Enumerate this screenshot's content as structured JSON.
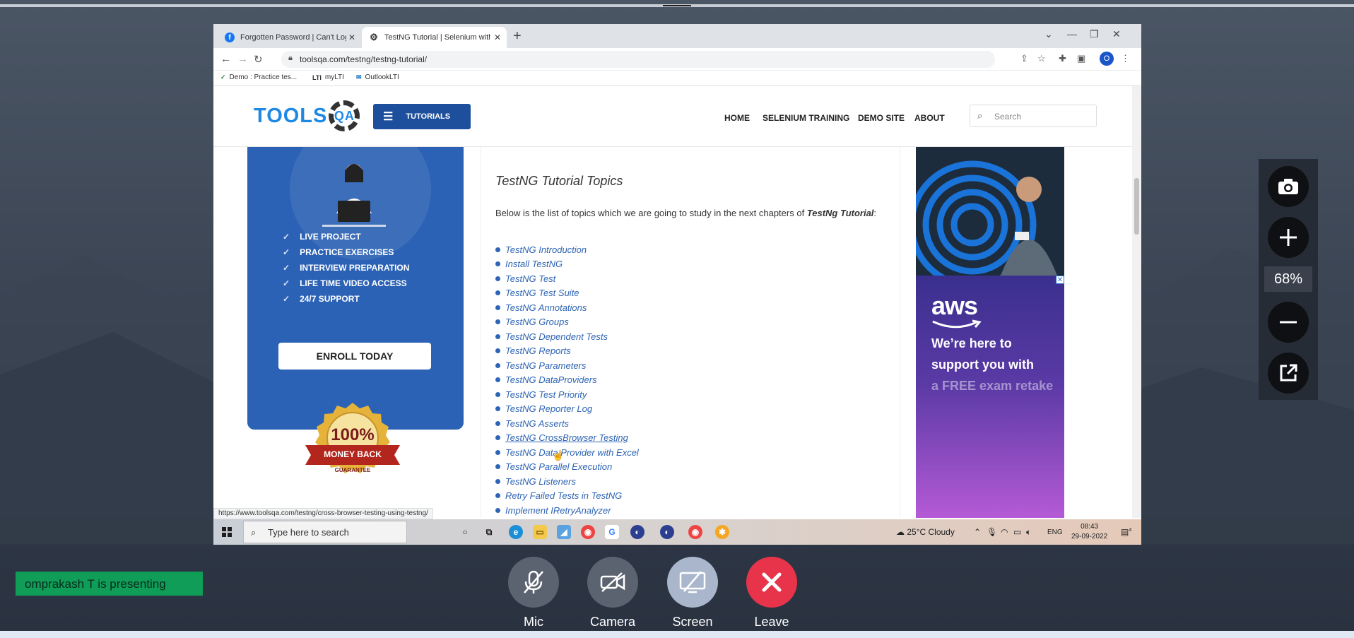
{
  "browser": {
    "tabs": [
      {
        "label": "Forgotten Password | Can't Log In",
        "icon": "facebook-icon"
      },
      {
        "label": "TestNG Tutorial | Selenium with Java",
        "icon": "gear-icon"
      }
    ],
    "url": "toolsqa.com/testng/testng-tutorial/",
    "profile_initial": "O",
    "bookmarks": [
      "Demo : Practice tes...",
      "myLTI",
      "OutlookLTI"
    ],
    "status_url": "https://www.toolsqa.com/testng/cross-browser-testing-using-testng/"
  },
  "site": {
    "logo_text": "TOOLS",
    "logo_mark": "QA",
    "tutorials_label": "TUTORIALS",
    "menu": [
      "HOME",
      "SELENIUM TRAINING",
      "DEMO SITE",
      "ABOUT"
    ],
    "search_placeholder": "Search"
  },
  "left_ad": {
    "features": [
      "LIVE PROJECT",
      "PRACTICE EXERCISES",
      "INTERVIEW PREPARATION",
      "LIFE TIME VIDEO ACCESS",
      "24/7 SUPPORT"
    ],
    "enroll_label": "ENROLL TODAY",
    "seal_line1": "100%",
    "seal_line2": "MONEY BACK",
    "seal_line3": "GUARANTEE"
  },
  "content": {
    "title": "TestNG Tutorial Topics",
    "intro_prefix": "Below is the list of topics which we are going to study in the next chapters of ",
    "intro_emph": "TestNg Tutorial",
    "intro_suffix": ":",
    "topics": [
      "TestNG Introduction",
      "Install TestNG",
      "TestNG Test",
      "TestNG Test Suite",
      "TestNG Annotations",
      "TestNG Groups",
      "TestNG Dependent Tests",
      "TestNG Reports",
      "TestNG Parameters",
      "TestNG DataProviders",
      "TestNG Test Priority",
      "TestNG Reporter Log",
      "TestNG Asserts",
      "TestNG CrossBrowser Testing",
      "TestNG Data Provider with Excel",
      "TestNG Parallel Execution",
      "TestNG Listeners",
      "Retry Failed Tests in TestNG",
      "Implement IRetryAnalyzer"
    ],
    "hovered_topic_index": 13
  },
  "right_ad": {
    "aws_logo": "aws",
    "lines": [
      "We’re here to",
      "support you with",
      "a FREE exam retake"
    ]
  },
  "taskbar": {
    "search_placeholder": "Type here to search",
    "weather": "25°C  Cloudy",
    "lang": "ENG",
    "time": "08:43",
    "date": "29-09-2022",
    "notifications": "4"
  },
  "meeting": {
    "presenting_text": "omprakash T is presenting",
    "controls": [
      "Mic",
      "Camera",
      "Screen",
      "Leave"
    ],
    "zoom_level": "68%"
  },
  "colors": {
    "accent": "#2e64b4",
    "leave": "#e8344a",
    "presenting_bg": "#0f9d58",
    "tutorials_btn": "#1e4f9c"
  }
}
